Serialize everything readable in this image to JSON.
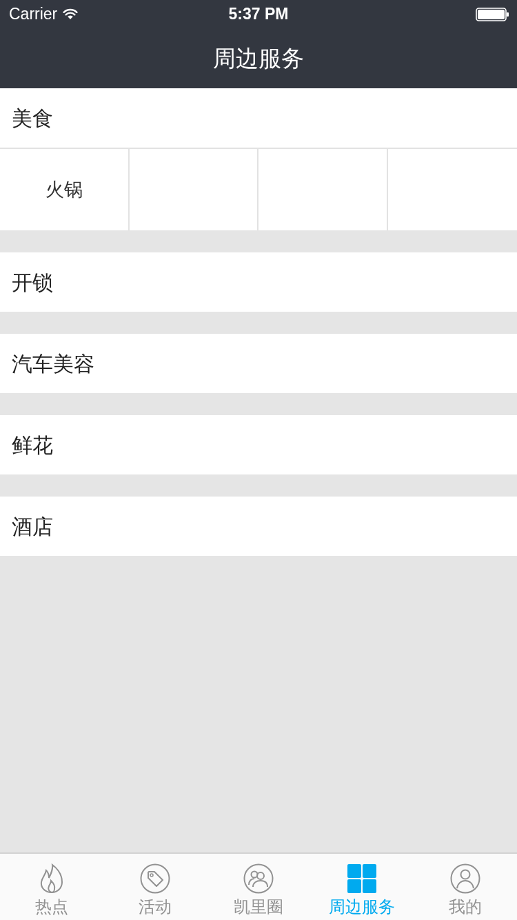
{
  "status_bar": {
    "carrier": "Carrier",
    "time": "5:37 PM"
  },
  "nav_bar": {
    "title": "周边服务"
  },
  "sections": [
    {
      "title": "美食",
      "items": [
        {
          "label": "火锅"
        }
      ]
    },
    {
      "title": "开锁"
    },
    {
      "title": "汽车美容"
    },
    {
      "title": "鲜花"
    },
    {
      "title": "酒店"
    }
  ],
  "tab_bar": {
    "tabs": [
      {
        "label": "热点",
        "selected": false
      },
      {
        "label": "活动",
        "selected": false
      },
      {
        "label": "凯里圈",
        "selected": false
      },
      {
        "label": "周边服务",
        "selected": true
      },
      {
        "label": "我的",
        "selected": false
      }
    ]
  }
}
